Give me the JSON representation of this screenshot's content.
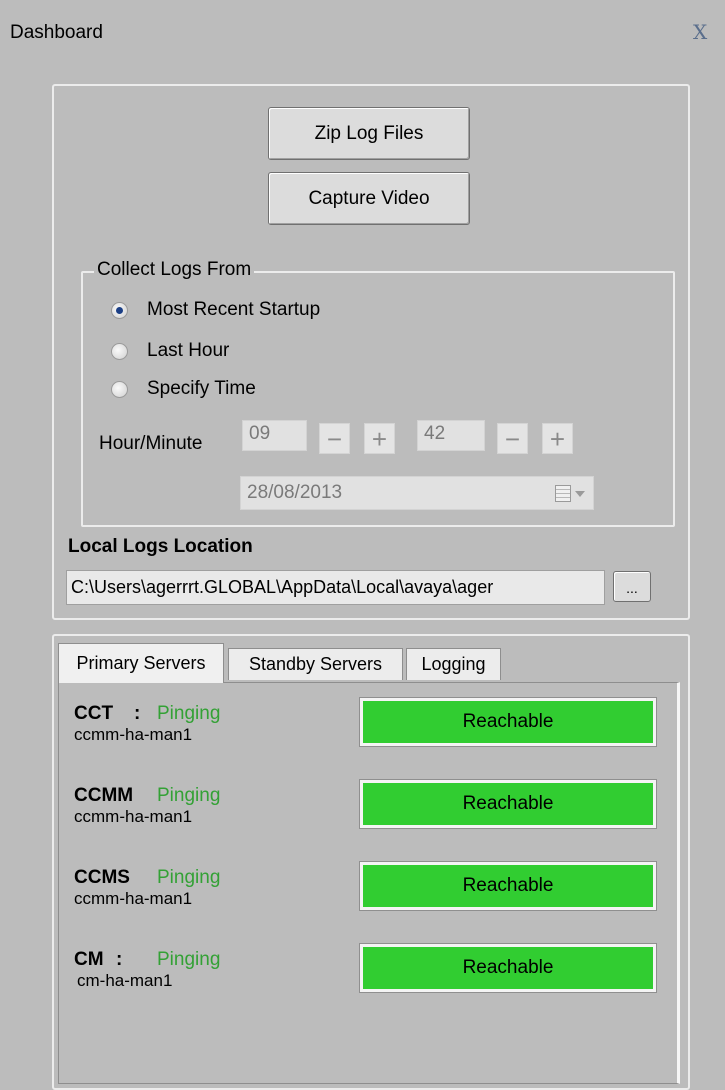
{
  "window": {
    "title": "Dashboard",
    "close_glyph": "X"
  },
  "buttons": {
    "zip": "Zip Log Files",
    "capture": "Capture Video",
    "browse": "..."
  },
  "collect": {
    "legend": "Collect Logs From",
    "options": [
      "Most Recent Startup",
      "Last Hour",
      "Specify Time"
    ],
    "selected": "Most Recent Startup",
    "hour_minute_label": "Hour/Minute",
    "hour": "09",
    "minute": "42",
    "minus_glyph": "−",
    "plus_glyph": "+",
    "date": "28/08/2013"
  },
  "local_logs": {
    "label": "Local Logs Location",
    "path": "C:\\Users\\agerrrt.GLOBAL\\AppData\\Local\\avaya\\ager"
  },
  "tabs": [
    "Primary Servers",
    "Standby Servers",
    "Logging"
  ],
  "active_tab": "Primary Servers",
  "servers": [
    {
      "name": "CCT",
      "colon": ":",
      "status": "Pinging",
      "host": "ccmm-ha-man1",
      "state": "Reachable"
    },
    {
      "name": "CCMM",
      "colon": "",
      "status": "Pinging",
      "host": "ccmm-ha-man1",
      "state": "Reachable"
    },
    {
      "name": "CCMS",
      "colon": "",
      "status": "Pinging",
      "host": "ccmm-ha-man1",
      "state": "Reachable"
    },
    {
      "name": "CM",
      "colon": ":",
      "status": "Pinging",
      "host": "cm-ha-man1",
      "state": "Reachable"
    }
  ],
  "colors": {
    "reachable": "#31cd31",
    "pinging": "#33a135",
    "background": "#bcbcbc"
  }
}
